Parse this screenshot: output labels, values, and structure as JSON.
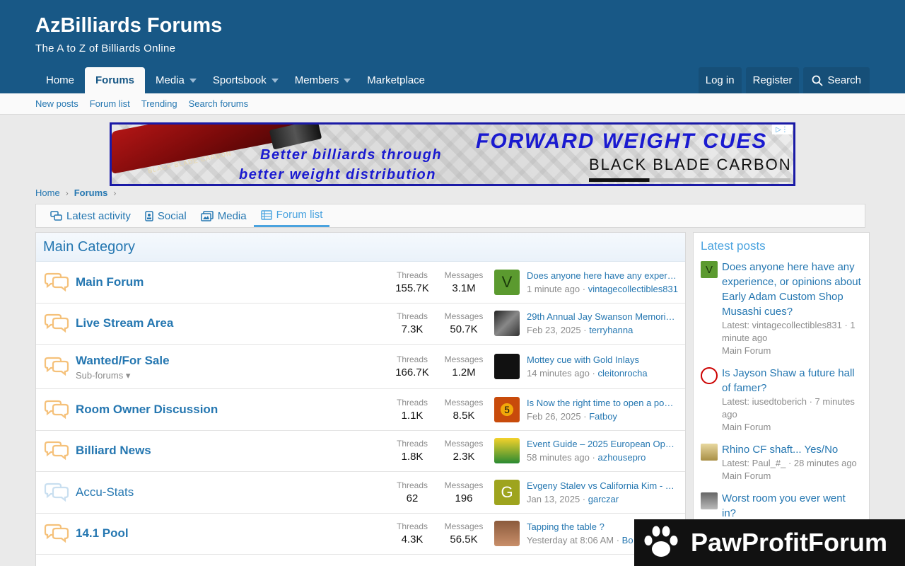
{
  "header": {
    "title": "AzBilliards Forums",
    "tagline": "The A to Z of Billiards Online",
    "nav": [
      "Home",
      "Forums",
      "Media",
      "Sportsbook",
      "Members",
      "Marketplace"
    ],
    "login": "Log in",
    "register": "Register",
    "search": "Search",
    "colors": {
      "header_bg": "#185886",
      "link": "#2577b1",
      "accent": "#4aa3df"
    }
  },
  "subnav": [
    "New posts",
    "Forum list",
    "Trending",
    "Search forums"
  ],
  "ad": {
    "headline": "FORWARD WEIGHT CUES",
    "line1": "Better billiards through",
    "line2": "better weight distribution",
    "brand": "BLACK BLADE CARBON",
    "cue_text": "BLACK BLADE CARBON"
  },
  "breadcrumb": [
    "Home",
    "Forums"
  ],
  "tabs": [
    "Latest activity",
    "Social",
    "Media",
    "Forum list"
  ],
  "category": "Main Category",
  "stat_labels": {
    "threads": "Threads",
    "messages": "Messages"
  },
  "forums": [
    {
      "title": "Main Forum",
      "threads": "155.7K",
      "messages": "3.1M",
      "last_title": "Does anyone here have any exper…",
      "last_time": "1 minute ago",
      "last_user": "vintagecollectibles831",
      "avatar_letter": "V"
    },
    {
      "title": "Live Stream Area",
      "threads": "7.3K",
      "messages": "50.7K",
      "last_title": "29th Annual Jay Swanson Memori…",
      "last_time": "Feb 23, 2025",
      "last_user": "terryhanna",
      "avatar_letter": ""
    },
    {
      "title": "Wanted/For Sale",
      "sub": "Sub-forums",
      "threads": "166.7K",
      "messages": "1.2M",
      "last_title": "Mottey cue with Gold Inlays",
      "last_time": "14 minutes ago",
      "last_user": "cleitonrocha",
      "avatar_letter": ""
    },
    {
      "title": "Room Owner Discussion",
      "threads": "1.1K",
      "messages": "8.5K",
      "last_title": "Is Now the right time to open a po…",
      "last_time": "Feb 26, 2025",
      "last_user": "Fatboy",
      "avatar_letter": "5"
    },
    {
      "title": "Billiard News",
      "threads": "1.8K",
      "messages": "2.3K",
      "last_title": "Event Guide – 2025 European Op…",
      "last_time": "58 minutes ago",
      "last_user": "azhousepro",
      "avatar_letter": ""
    },
    {
      "title": "Accu-Stats",
      "threads": "62",
      "messages": "196",
      "last_title": "Evgeny Stalev vs California Kim - …",
      "last_time": "Jan 13, 2025",
      "last_user": "garczar",
      "avatar_letter": "G"
    },
    {
      "title": "14.1 Pool",
      "threads": "4.3K",
      "messages": "56.5K",
      "last_title": "Tapping the table ?",
      "last_time": "Yesterday at 8:06 AM",
      "last_user": "Bo",
      "avatar_letter": ""
    }
  ],
  "sidebar": {
    "title": "Latest posts",
    "items": [
      {
        "title": "Does anyone here have any experience, or opinions about Early Adam Custom Shop Musashi cues?",
        "latest": "Latest: vintagecollectibles831 · 1 minute ago",
        "forum": "Main Forum",
        "avatar_letter": "V"
      },
      {
        "title": "Is Jayson Shaw a future hall of famer?",
        "latest": "Latest: iusedtoberich · 7 minutes ago",
        "forum": "Main Forum",
        "avatar_letter": ""
      },
      {
        "title": "Rhino CF shaft... Yes/No",
        "latest": "Latest: Paul_#_ · 28 minutes ago",
        "forum": "Main Forum",
        "avatar_letter": ""
      },
      {
        "title": "Worst room you ever went in?",
        "latest": "",
        "forum": "",
        "avatar_letter": ""
      }
    ]
  },
  "watermark": "PawProfitForum"
}
